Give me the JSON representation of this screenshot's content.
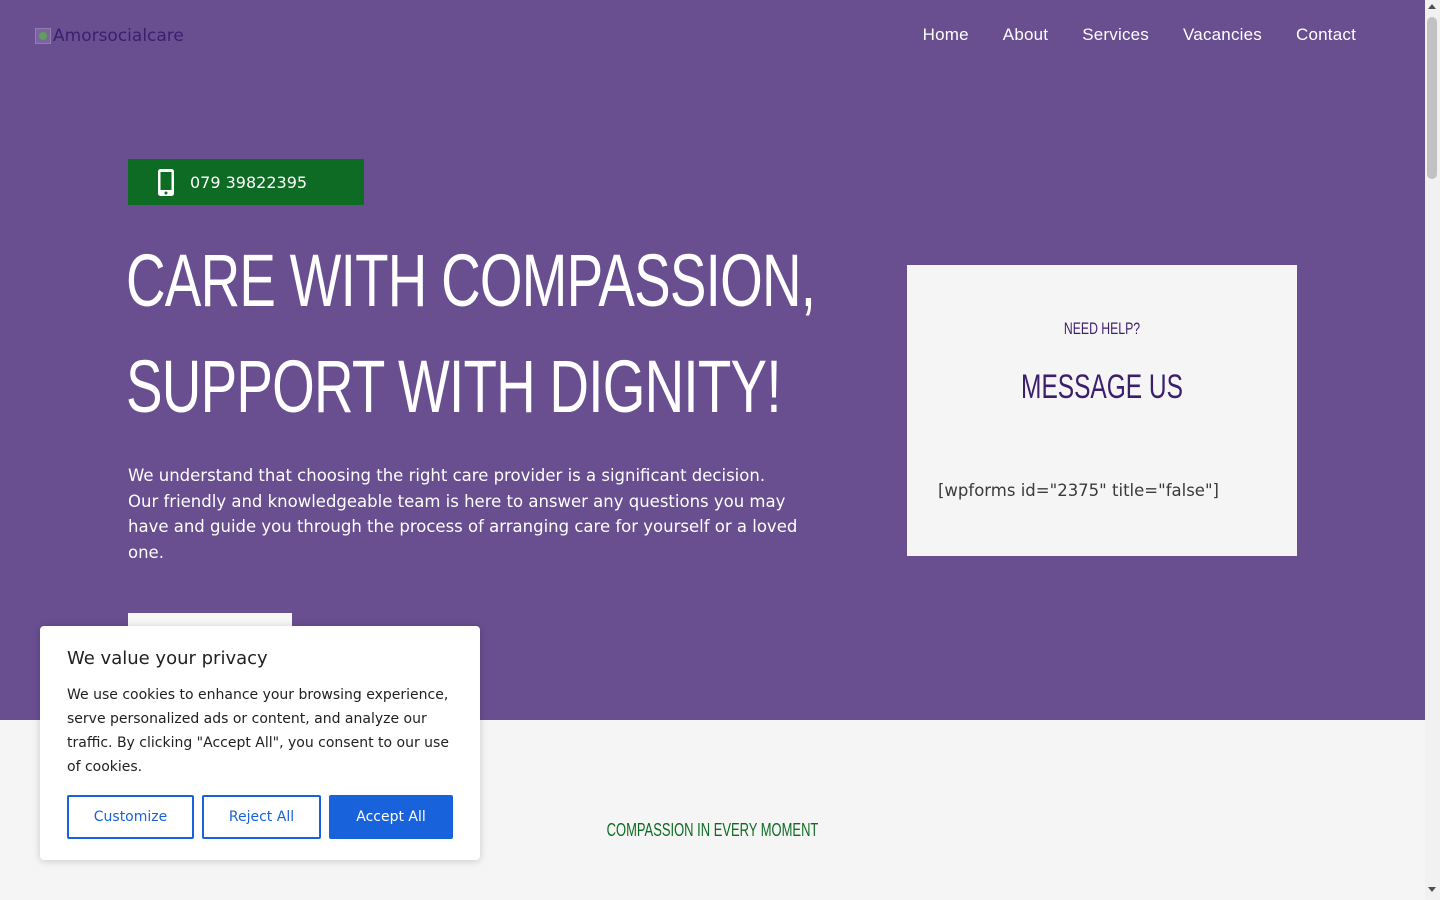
{
  "header": {
    "logo_alt": "Amorsocialcare",
    "nav": [
      {
        "label": "Home"
      },
      {
        "label": "About"
      },
      {
        "label": "Services"
      },
      {
        "label": "Vacancies"
      },
      {
        "label": "Contact"
      }
    ]
  },
  "hero": {
    "phone": "079 39822395",
    "headline_line1": "CARE WITH COMPASSION,",
    "headline_line2": "SUPPORT WITH DIGNITY!",
    "intro": "We understand that choosing the right care provider is a significant decision. Our friendly and knowledgeable team is here to answer any questions you may have and guide you through the process of arranging care for yourself or a loved one."
  },
  "help_card": {
    "eyebrow": "NEED HELP?",
    "title": "MESSAGE US",
    "shortcode": "[wpforms id=\"2375\" title=\"false\"]"
  },
  "section": {
    "eyebrow": "COMPASSION IN EVERY MOMENT"
  },
  "cookie_banner": {
    "title": "We value your privacy",
    "text": "We use cookies to enhance your browsing experience, serve personalized ads or content, and analyze our traffic. By clicking \"Accept All\", you consent to our use of cookies.",
    "customize_label": "Customize",
    "reject_label": "Reject All",
    "accept_label": "Accept All"
  },
  "colors": {
    "hero_bg": "#694e90",
    "phone_btn_bg": "#0e6b23",
    "card_heading": "#3b1e6c",
    "accent_blue": "#1863dc"
  },
  "icons": {
    "phone": "mobile-phone-icon",
    "logo": "broken-image-icon"
  }
}
